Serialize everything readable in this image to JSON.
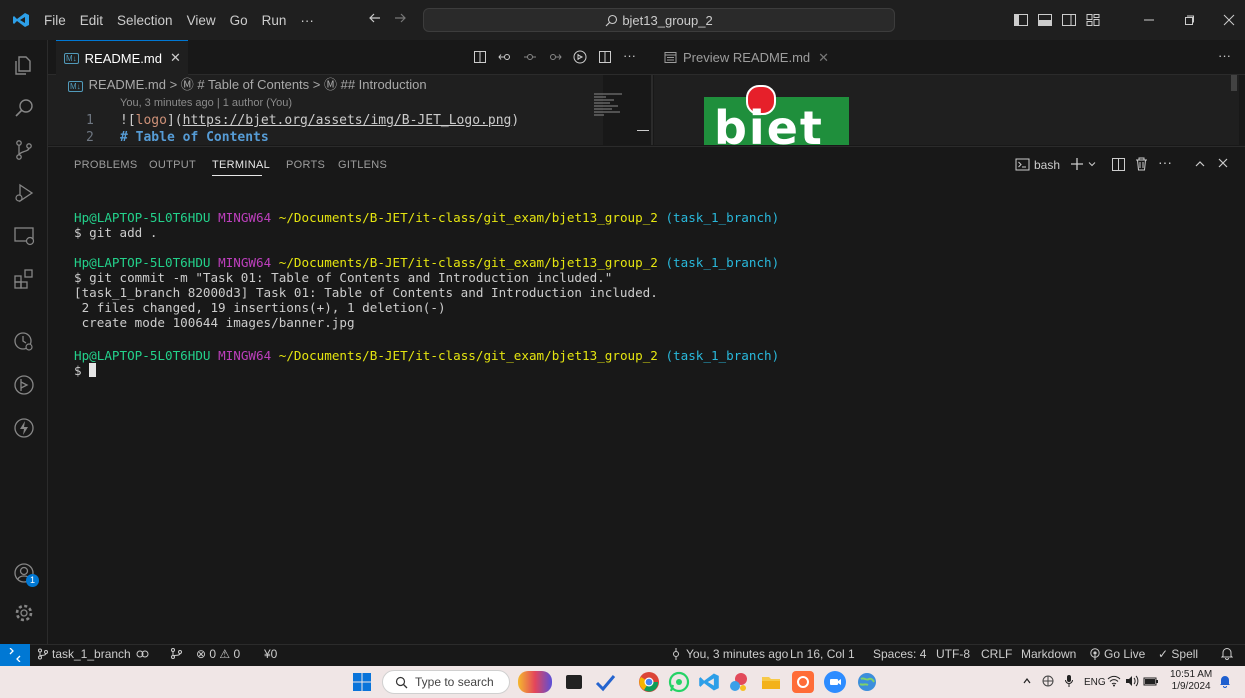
{
  "titlebar": {
    "menu": [
      "File",
      "Edit",
      "Selection",
      "View",
      "Go",
      "Run",
      "···"
    ],
    "search": "bjet13_group_2"
  },
  "editor": {
    "tab_label": "README.md",
    "preview_tab_label": "Preview README.md",
    "breadcrumb": "README.md > Ⓜ # Table of Contents > Ⓜ ## Introduction",
    "blame": "You, 3 minutes ago | 1 author (You)",
    "lines": [
      {
        "num": "1",
        "text": "![logo](https://bjet.org/assets/img/B-JET_Logo.png)"
      },
      {
        "num": "2",
        "text": "# Table of Contents"
      }
    ],
    "line1_prefix": "![",
    "line1_alt": "logo",
    "line1_mid": "](",
    "line1_url": "https://bjet.org/assets/img/B-JET_Logo.png",
    "line1_suffix": ")",
    "line2_text": "# Table of Contents",
    "preview_logo_text": "biet"
  },
  "panel": {
    "tabs": [
      "PROBLEMS",
      "OUTPUT",
      "TERMINAL",
      "PORTS",
      "GITLENS"
    ],
    "active_tab": "TERMINAL",
    "shell": "bash",
    "prompt_user": "Hp@LAPTOP-5L0T6HDU",
    "prompt_env": "MINGW64",
    "prompt_path": "~/Documents/B-JET/it-class/git_exam/bjet13_group_2",
    "prompt_branch": "(task_1_branch)",
    "cmd1": "$ git add .",
    "cmd2": "$ git commit -m \"Task 01: Table of Contents and Introduction included.\"",
    "out1": "[task_1_branch 82000d3] Task 01: Table of Contents and Introduction included.",
    "out2": " 2 files changed, 19 insertions(+), 1 deletion(-)",
    "out3": " create mode 100644 images/banner.jpg",
    "cmd3": "$ "
  },
  "statusbar": {
    "branch": "task_1_branch",
    "problems": "⊗ 0 ⚠ 0",
    "ports": "¥0",
    "blame": "You, 3 minutes ago",
    "position": "Ln 16, Col 1",
    "spaces": "Spaces: 4",
    "encoding": "UTF-8",
    "eol": "CRLF",
    "language": "Markdown",
    "golive": "Go Live",
    "spell": "✓ Spell",
    "accounts_badge": "1"
  },
  "taskbar": {
    "search_placeholder": "Type to search",
    "lang": "ENG",
    "time": "10:51 AM",
    "date": "1/9/2024"
  },
  "colors": {
    "accent": "#0078d4",
    "terminal_green": "#23d18b",
    "terminal_magenta": "#bc3fbc",
    "terminal_yellow": "#e5e510",
    "terminal_cyan": "#29b8db"
  }
}
